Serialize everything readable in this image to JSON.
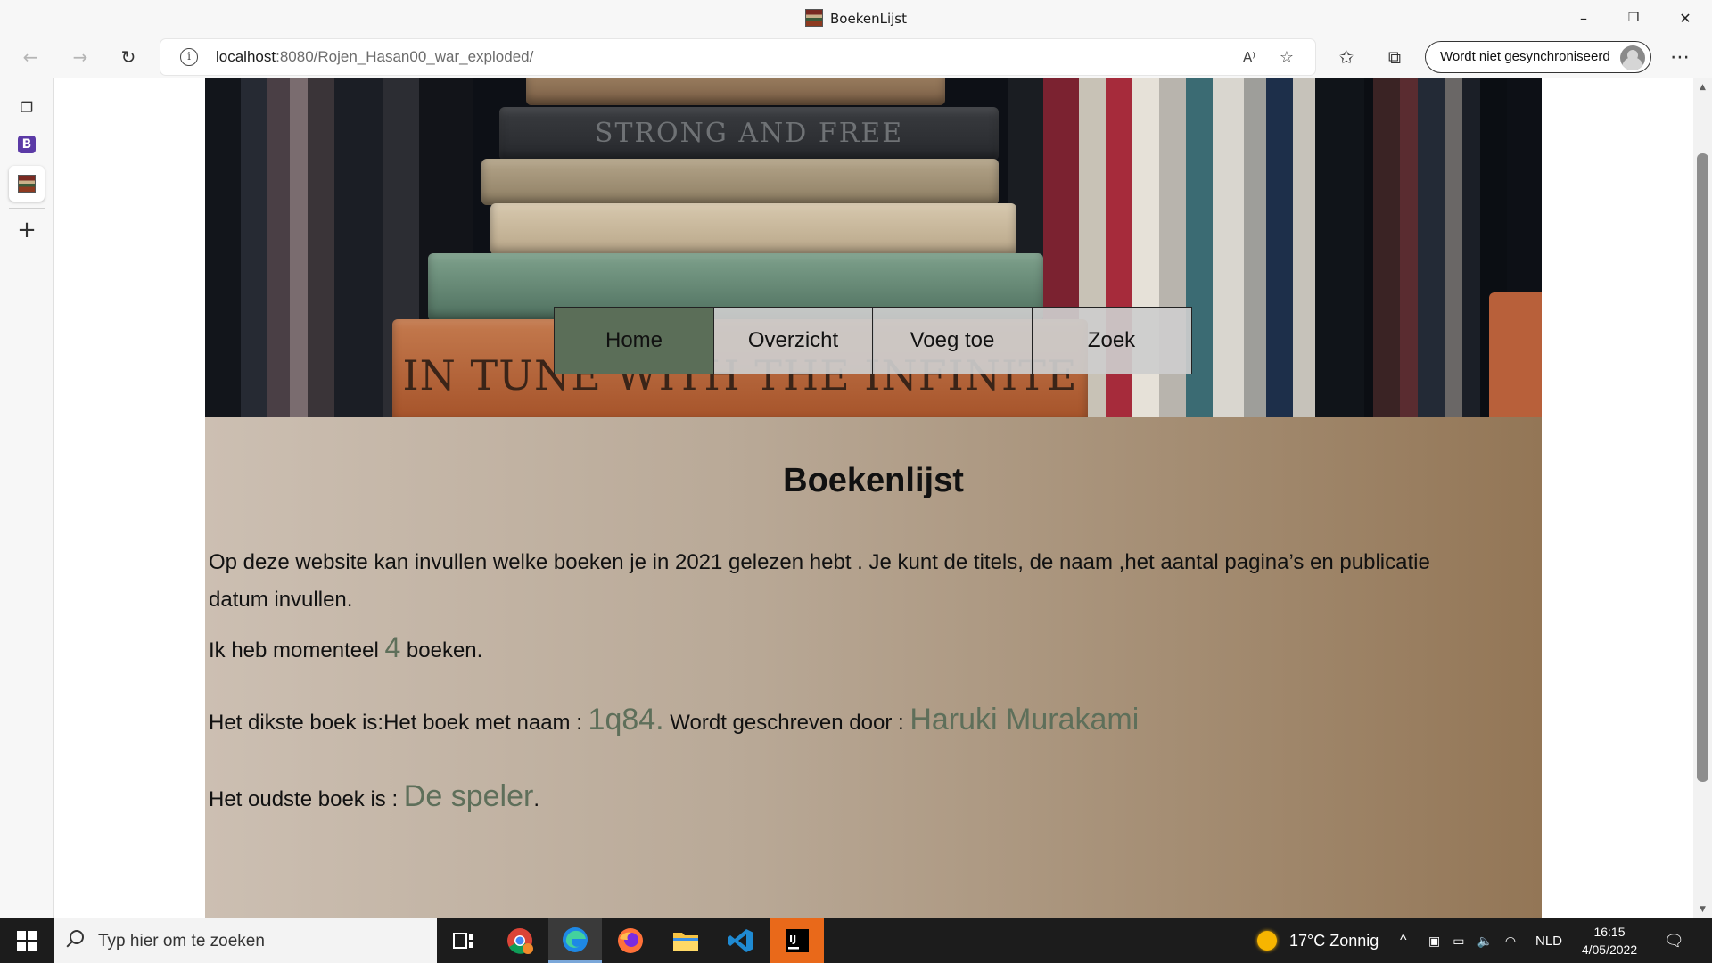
{
  "window": {
    "title": "BoekenLijst",
    "minimize_glyph": "–",
    "restore_glyph": "❐",
    "close_glyph": "✕"
  },
  "toolbar": {
    "back_glyph": "←",
    "forward_glyph": "→",
    "reload_glyph": "↻",
    "url_host": "localhost",
    "url_rest": ":8080/Rojen_Hasan00_war_exploded/",
    "read_aloud_glyph": "A⁾",
    "favorite_add_glyph": "☆",
    "favorites_glyph": "✩",
    "collections_glyph": "⧉",
    "sync_label": "Wordt niet gesynchroniseerd",
    "more_glyph": "⋯"
  },
  "sidebar": {
    "tab_actions_glyph": "❐",
    "tab_b_letter": "B",
    "new_tab_glyph": "+"
  },
  "hero": {
    "book_top_text": "STRONG AND FREE",
    "book_bottom_text": "IN TUNE WITH THE INFINITE"
  },
  "nav": {
    "items": [
      {
        "label": "Home",
        "active": true
      },
      {
        "label": "Overzicht",
        "active": false
      },
      {
        "label": "Voeg toe",
        "active": false
      },
      {
        "label": "Zoek",
        "active": false
      }
    ]
  },
  "content": {
    "title": "Boekenlijst",
    "intro": "Op deze website kan invullen welke boeken je in 2021 gelezen hebt . Je kunt de titels, de naam ,het aantal pagina’s en publicatie datum invullen.",
    "count_prefix": "Ik heb momenteel ",
    "count_value": "4",
    "count_suffix": " boeken.",
    "thickest_prefix": "Het dikste boek is:Het boek met naam : ",
    "thickest_title": "1q84.",
    "thickest_author_prefix": " Wordt geschreven door : ",
    "thickest_author": "Haruki Murakami",
    "oldest_prefix": "Het oudste boek is : ",
    "oldest_title": "De speler",
    "oldest_suffix": "."
  },
  "taskbar": {
    "search_placeholder": "Typ hier om te zoeken",
    "weather": "17°C  Zonnig",
    "tray_up_glyph": "^",
    "language": "NLD",
    "time": "16:15",
    "date": "4/05/2022",
    "notification_glyph": "🗨"
  },
  "colors": {
    "nav_active": "#5b6e58",
    "highlight_text": "#5e6f5a",
    "panel_left": "#ccbfb2",
    "panel_right": "#937656",
    "taskbar": "#1c1c1c"
  }
}
